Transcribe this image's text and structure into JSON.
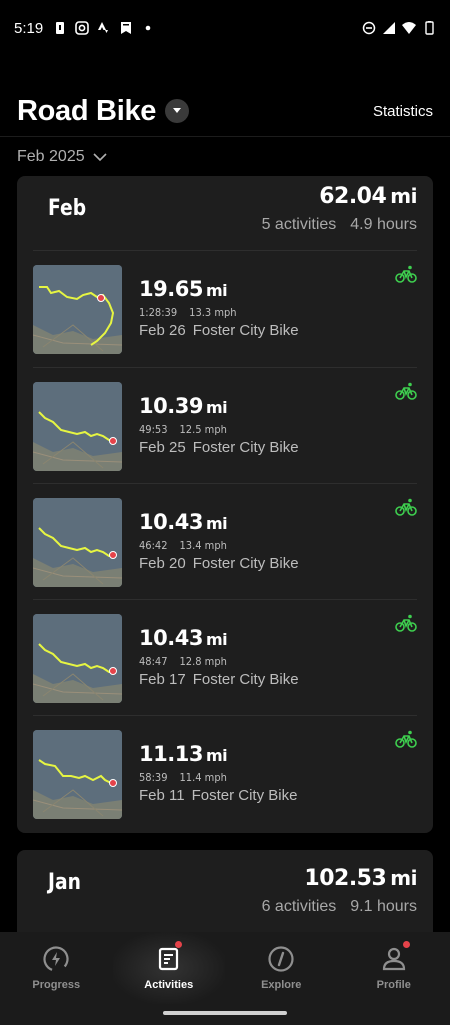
{
  "status": {
    "time": "5:19"
  },
  "header": {
    "title": "Road Bike",
    "statistics_label": "Statistics"
  },
  "filter": {
    "month": "Feb 2025"
  },
  "months": [
    {
      "label": "Feb",
      "total": "62.04",
      "unit": "mi",
      "activities": "5 activities",
      "hours": "4.9 hours",
      "items": [
        {
          "distance": "19.65",
          "unit": "mi",
          "duration": "1:28:39",
          "speed": "13.3 mph",
          "date": "Feb 26",
          "name": "Foster City Bike"
        },
        {
          "distance": "10.39",
          "unit": "mi",
          "duration": "49:53",
          "speed": "12.5 mph",
          "date": "Feb 25",
          "name": "Foster City Bike"
        },
        {
          "distance": "10.43",
          "unit": "mi",
          "duration": "46:42",
          "speed": "13.4 mph",
          "date": "Feb 20",
          "name": "Foster City Bike"
        },
        {
          "distance": "10.43",
          "unit": "mi",
          "duration": "48:47",
          "speed": "12.8 mph",
          "date": "Feb 17",
          "name": "Foster City Bike"
        },
        {
          "distance": "11.13",
          "unit": "mi",
          "duration": "58:39",
          "speed": "11.4 mph",
          "date": "Feb 11",
          "name": "Foster City Bike"
        }
      ]
    },
    {
      "label": "Jan",
      "total": "102.53",
      "unit": "mi",
      "activities": "6 activities",
      "hours": "9.1 hours"
    }
  ],
  "nav": {
    "progress": "Progress",
    "activities": "Activities",
    "explore": "Explore",
    "profile": "Profile"
  },
  "colors": {
    "route": "#e6f542",
    "bike_icon": "#3ecf4f",
    "badge": "#e5434a"
  }
}
